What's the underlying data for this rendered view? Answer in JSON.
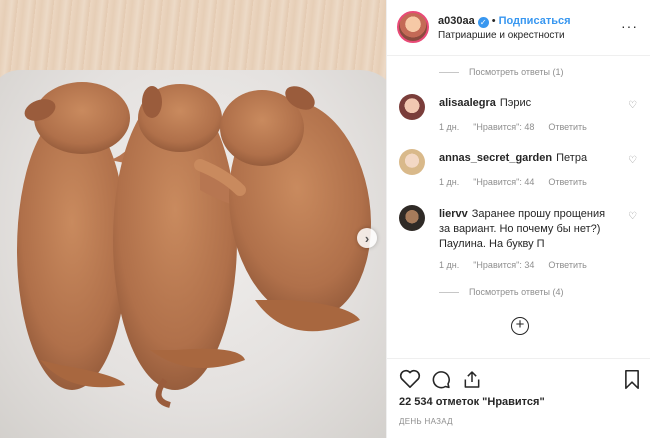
{
  "post": {
    "username": "a030aa",
    "separator": "•",
    "follow_label": "Подписаться",
    "location": "Патриаршие и окрестности",
    "more_icon": "ellipsis-icon"
  },
  "comments_section": {
    "view_replies_top": "Посмотреть ответы (1)",
    "comments": [
      {
        "user": "alisaalegra",
        "text": "Пэрис",
        "time": "1 дн.",
        "likes": "\"Нравится\": 48",
        "reply": "Ответить"
      },
      {
        "user": "annas_secret_garden",
        "text": "Петра",
        "time": "1 дн.",
        "likes": "\"Нравится\": 44",
        "reply": "Ответить"
      },
      {
        "user": "liervv",
        "text": "Заранее прошу прощения за вариант. Но почему бы нет?) Паулина. На букву П",
        "time": "1 дн.",
        "likes": "\"Нравится\": 34",
        "reply": "Ответить"
      }
    ],
    "view_replies_bottom": "Посмотреть ответы (4)"
  },
  "footer": {
    "likes_text": "22 534 отметок \"Нравится\"",
    "timestamp": "ДЕНЬ НАЗАД"
  },
  "colors": {
    "accent": "#3897f0",
    "muted": "#8e8e8e",
    "text": "#262626"
  }
}
